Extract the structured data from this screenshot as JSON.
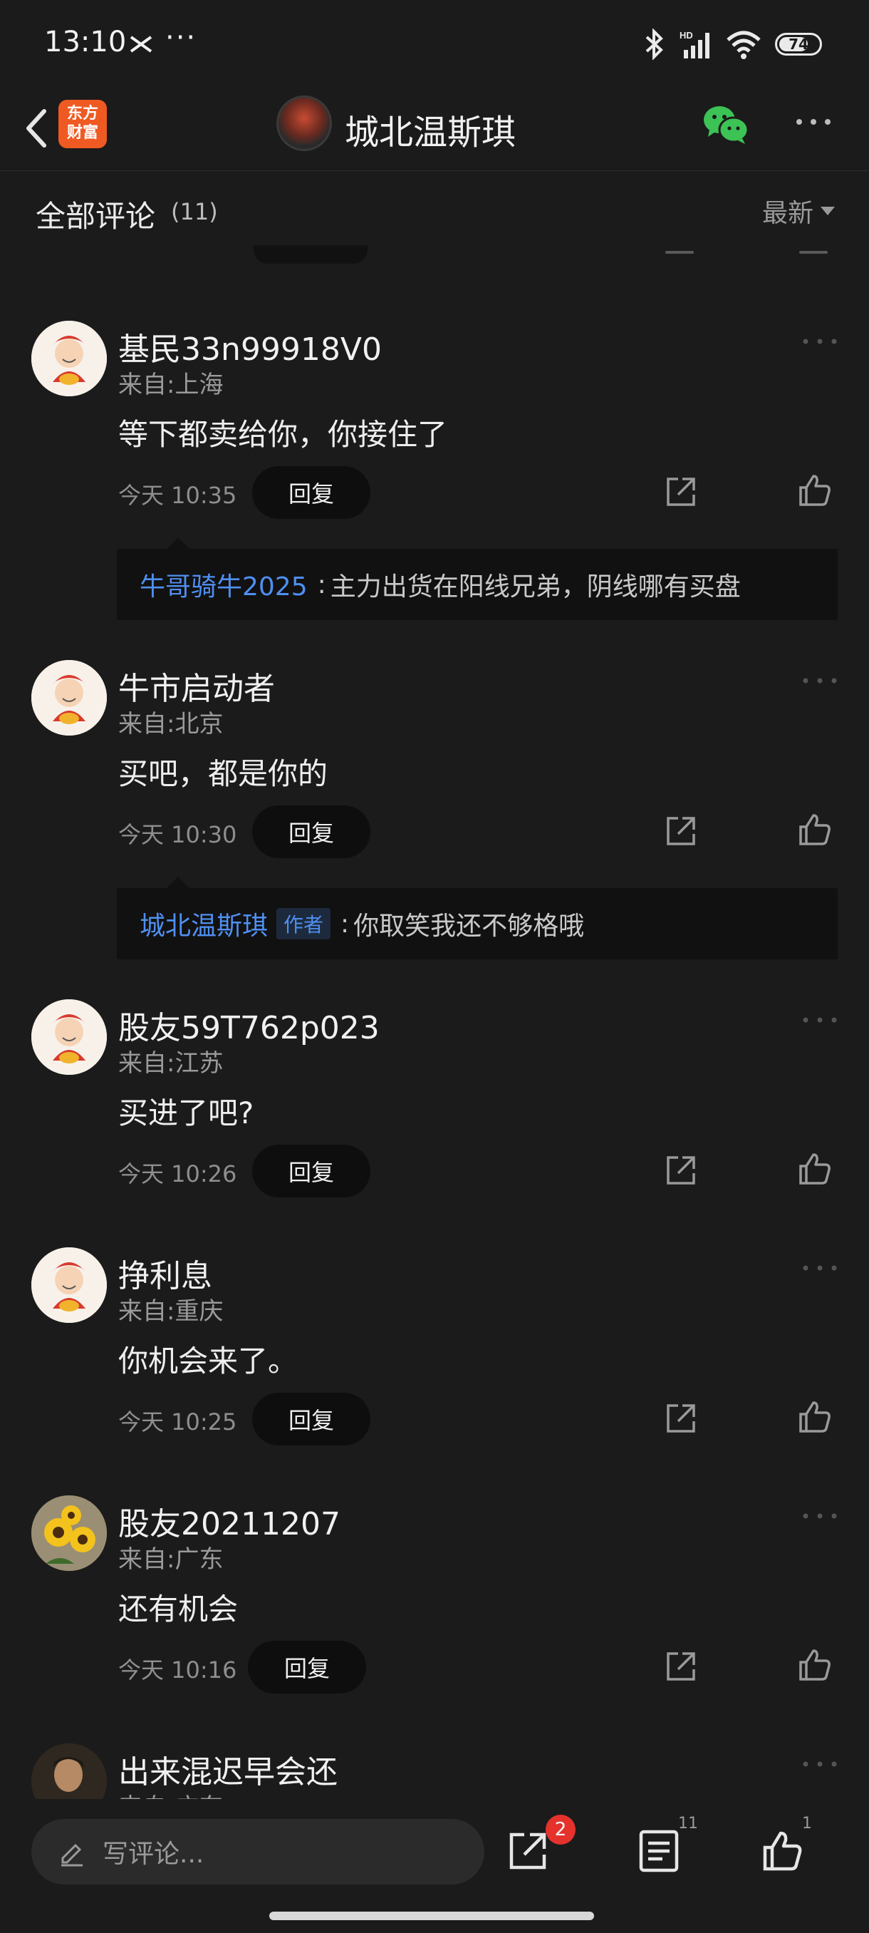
{
  "status_bar": {
    "time": "13:10",
    "dots": "···",
    "battery": "74",
    "battery_level": 0.74,
    "icons": [
      "bluetooth-icon",
      "hd-signal-icon",
      "wifi-icon",
      "battery-icon"
    ]
  },
  "nav": {
    "logo_line1": "东方",
    "logo_line2": "财富",
    "title": "城北温斯琪"
  },
  "comments_header": {
    "title": "全部评论",
    "count": "(11)",
    "sort": "最新"
  },
  "comments": [
    {
      "name": "基民33n99918V0",
      "location": "来自:上海",
      "text": "等下都卖给你，你接住了",
      "time": "今天 10:35",
      "reply_label": "回复",
      "reply": {
        "author": "牛哥骑牛2025",
        "tag": "",
        "text": "主力出货在阳线兄弟，阴线哪有买盘"
      }
    },
    {
      "name": "牛市启动者",
      "location": "来自:北京",
      "text": "买吧，都是你的",
      "time": "今天 10:30",
      "reply_label": "回复",
      "reply": {
        "author": "城北温斯琪",
        "tag": "作者",
        "text": "你取笑我还不够格哦"
      }
    },
    {
      "name": "股友59T762p023",
      "location": "来自:江苏",
      "text": "买进了吧?",
      "time": "今天 10:26",
      "reply_label": "回复"
    },
    {
      "name": "挣利息",
      "location": "来自:重庆",
      "text": "你机会来了。",
      "time": "今天 10:25",
      "reply_label": "回复"
    },
    {
      "name": "股友20211207",
      "location": "来自:广东",
      "text": "还有机会",
      "time": "今天 10:16",
      "reply_label": "回复"
    },
    {
      "name": "出来混迟早会还",
      "location": "来自:广东"
    }
  ],
  "bottom_bar": {
    "placeholder": "写评论...",
    "share_badge": "2",
    "comments_count": "11",
    "likes_count": "1"
  }
}
